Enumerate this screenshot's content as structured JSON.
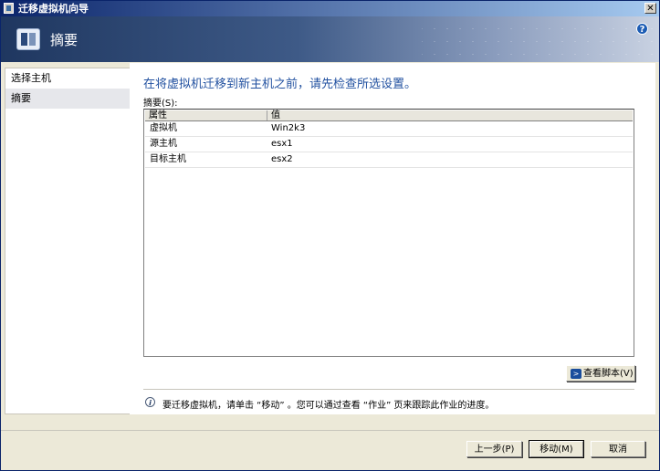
{
  "window": {
    "title": "迁移虚拟机向导",
    "close_glyph": "✕"
  },
  "header": {
    "title": "摘要",
    "help_glyph": "?"
  },
  "nav": {
    "items": [
      {
        "label": "选择主机"
      },
      {
        "label": "摘要"
      }
    ]
  },
  "content": {
    "intro": "在将虚拟机迁移到新主机之前，请先检查所选设置。",
    "summary_label": "摘要(S):",
    "columns": {
      "property": "属性",
      "value": "值"
    },
    "rows": [
      {
        "property": "虚拟机",
        "value": "Win2k3"
      },
      {
        "property": "源主机",
        "value": "esx1"
      },
      {
        "property": "目标主机",
        "value": "esx2"
      }
    ],
    "view_script_button": "查看脚本(V)",
    "info_text": "要迁移虚拟机，请单击 “移动” 。您可以通过查看 “作业” 页来跟踪此作业的进度。"
  },
  "footer": {
    "back_label": "上一步(P)",
    "move_label": "移动(M)",
    "cancel_label": "取消"
  },
  "icons": [
    "app-icon",
    "close-icon",
    "wizard-header-icon",
    "help-icon",
    "powershell-icon",
    "info-icon"
  ]
}
